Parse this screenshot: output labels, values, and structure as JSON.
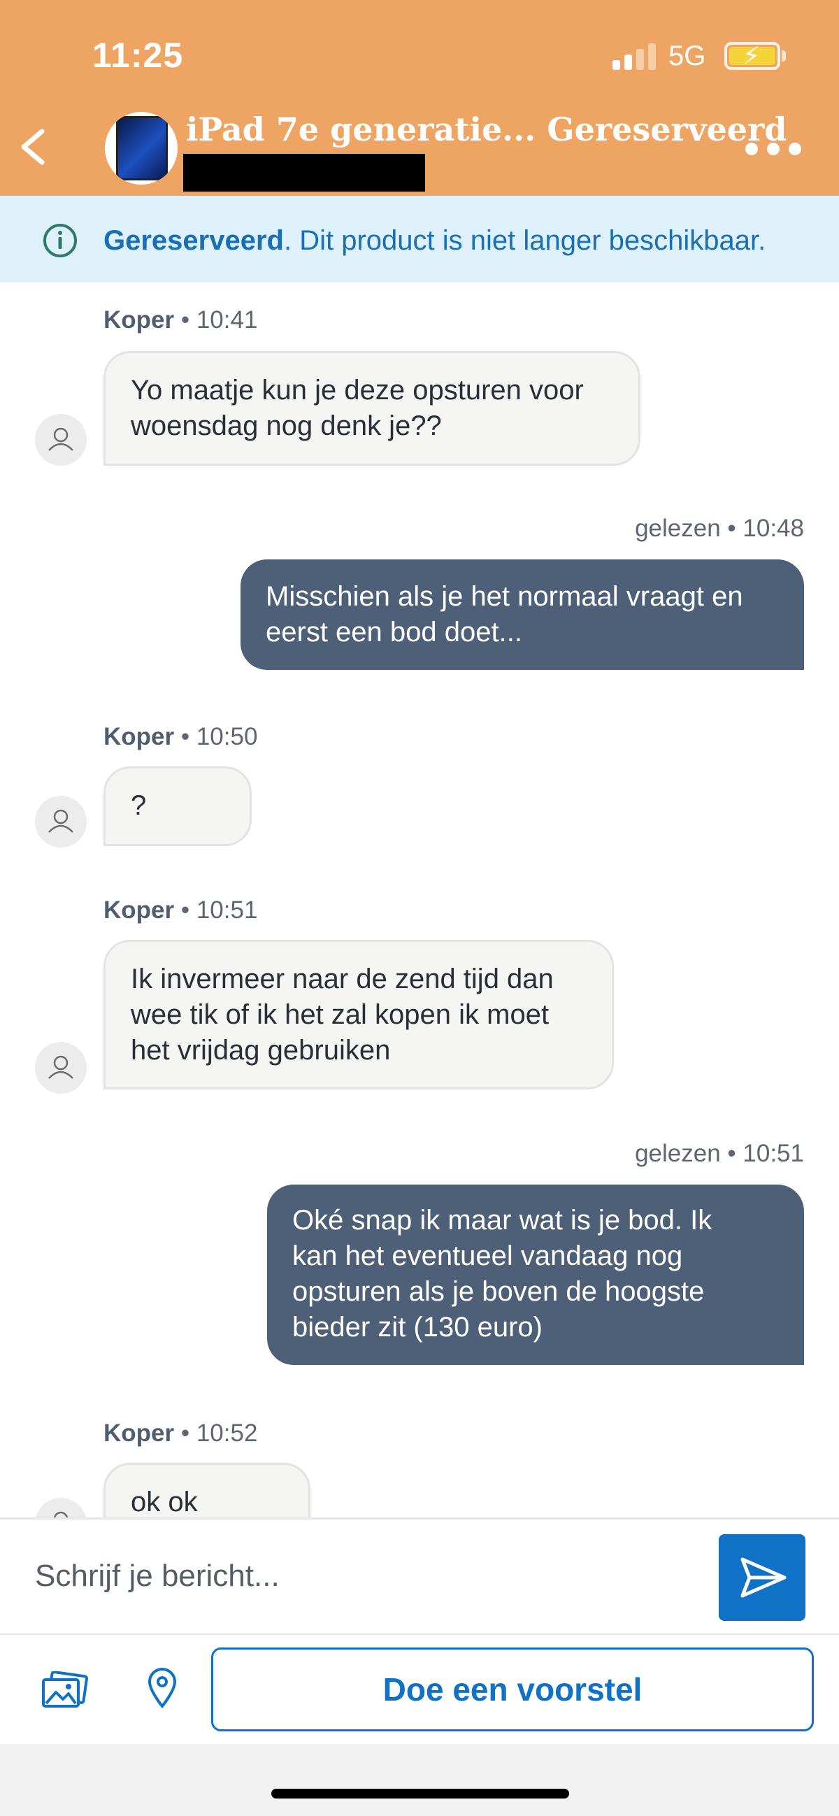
{
  "status_bar": {
    "time": "11:25",
    "network": "5G"
  },
  "header": {
    "title": "iPad 7e generatie... Gereserveerd",
    "back_icon": "chevron-left-icon",
    "more_icon": "more-horizontal-icon"
  },
  "banner": {
    "status": "Gereserveerd",
    "text": ". Dit product is niet langer beschikbaar.",
    "icon": "info-icon"
  },
  "messages": [
    {
      "direction": "in",
      "sender": "Koper",
      "time": "10:41",
      "lines": [
        "Yo maatje kun je deze opsturen voor",
        "woensdag nog denk je??"
      ]
    },
    {
      "direction": "out",
      "status": "gelezen",
      "time": "10:48",
      "lines": [
        "Misschien als je het normaal vraagt en",
        "eerst een bod doet..."
      ]
    },
    {
      "direction": "in",
      "sender": "Koper",
      "time": "10:50",
      "lines": [
        "?"
      ]
    },
    {
      "direction": "in",
      "sender": "Koper",
      "time": "10:51",
      "lines": [
        "Ik invermeer naar de zend tijd dan",
        "wee tik of ik het zal kopen ik moet",
        "het vrijdag gebruiken"
      ]
    },
    {
      "direction": "out",
      "status": "gelezen",
      "time": "10:51",
      "lines": [
        "Oké snap ik maar wat is je bod. Ik",
        "kan het eventueel vandaag nog",
        "opsturen als je boven de hoogste",
        "bieder zit (130 euro)"
      ]
    },
    {
      "direction": "in",
      "sender": "Koper",
      "time": "10:52",
      "lines": [
        "ok ok"
      ]
    }
  ],
  "meta_separator": " • ",
  "compose": {
    "placeholder": "Schrijf je bericht...",
    "value": "",
    "send_icon": "send-icon"
  },
  "actions": {
    "image_icon": "image-icon",
    "location_icon": "location-pin-icon",
    "proposal_label": "Doe een voorstel"
  },
  "colors": {
    "header": "#eea463",
    "banner_bg": "#def1fa",
    "accent": "#0f72c6",
    "outgoing_bubble": "#4d6078"
  }
}
